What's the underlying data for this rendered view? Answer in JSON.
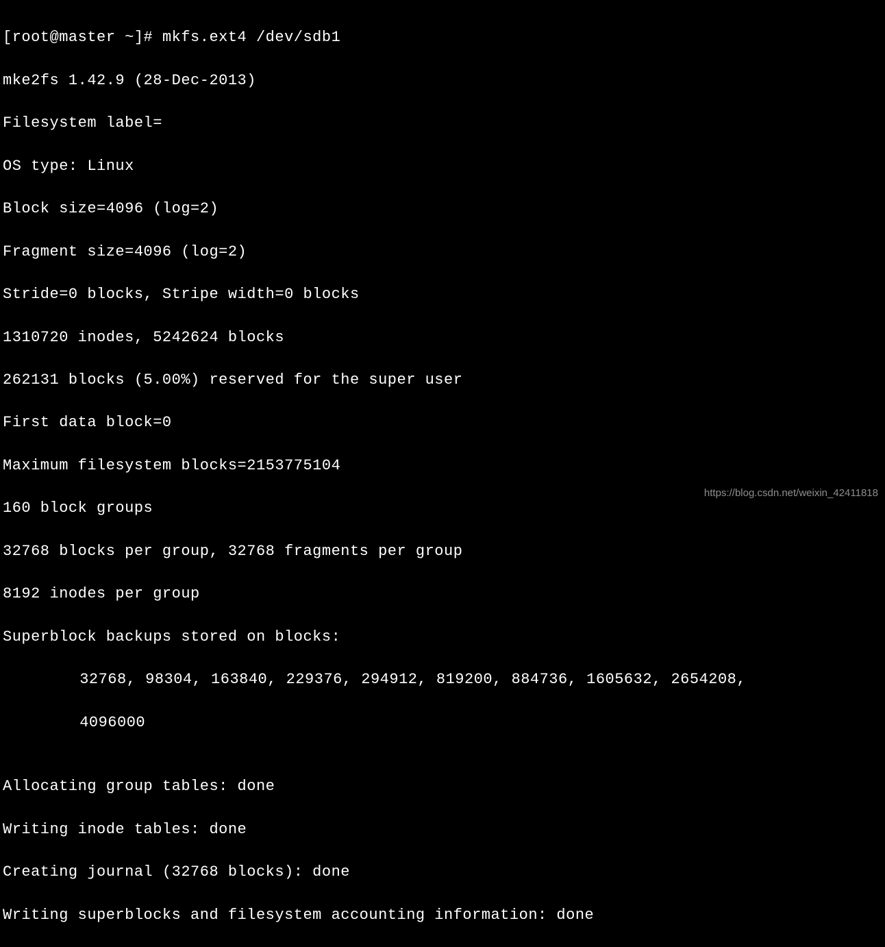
{
  "terminal": {
    "prompt": "[root@master ~]# ",
    "command": "mkfs.ext4 /dev/sdb1",
    "lines": {
      "l1": "mke2fs 1.42.9 (28-Dec-2013)",
      "l2": "Filesystem label=",
      "l3": "OS type: Linux",
      "l4": "Block size=4096 (log=2)",
      "l5": "Fragment size=4096 (log=2)",
      "l6": "Stride=0 blocks, Stripe width=0 blocks",
      "l7": "1310720 inodes, 5242624 blocks",
      "l8": "262131 blocks (5.00%) reserved for the super user",
      "l9": "First data block=0",
      "l10": "Maximum filesystem blocks=2153775104",
      "l11": "160 block groups",
      "l12": "32768 blocks per group, 32768 fragments per group",
      "l13": "8192 inodes per group",
      "l14": "Superblock backups stored on blocks: ",
      "l15": "32768, 98304, 163840, 229376, 294912, 819200, 884736, 1605632, 2654208, ",
      "l16": "4096000",
      "l17": "",
      "l18": "Allocating group tables: done",
      "l19": "Writing inode tables: done",
      "l20": "Creating journal (32768 blocks): done",
      "l21": "Writing superblocks and filesystem accounting information: done"
    }
  },
  "watermark": "https://blog.csdn.net/weixin_42411818"
}
